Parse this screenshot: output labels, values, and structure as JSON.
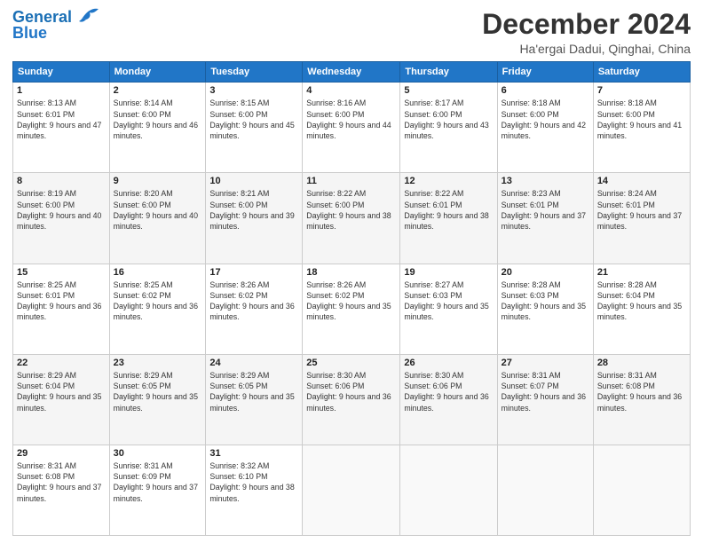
{
  "logo": {
    "line1": "General",
    "line2": "Blue"
  },
  "title": "December 2024",
  "subtitle": "Ha'ergai Dadui, Qinghai, China",
  "weekdays": [
    "Sunday",
    "Monday",
    "Tuesday",
    "Wednesday",
    "Thursday",
    "Friday",
    "Saturday"
  ],
  "weeks": [
    [
      {
        "day": "1",
        "sunrise": "8:13 AM",
        "sunset": "6:01 PM",
        "daylight": "9 hours and 47 minutes."
      },
      {
        "day": "2",
        "sunrise": "8:14 AM",
        "sunset": "6:00 PM",
        "daylight": "9 hours and 46 minutes."
      },
      {
        "day": "3",
        "sunrise": "8:15 AM",
        "sunset": "6:00 PM",
        "daylight": "9 hours and 45 minutes."
      },
      {
        "day": "4",
        "sunrise": "8:16 AM",
        "sunset": "6:00 PM",
        "daylight": "9 hours and 44 minutes."
      },
      {
        "day": "5",
        "sunrise": "8:17 AM",
        "sunset": "6:00 PM",
        "daylight": "9 hours and 43 minutes."
      },
      {
        "day": "6",
        "sunrise": "8:18 AM",
        "sunset": "6:00 PM",
        "daylight": "9 hours and 42 minutes."
      },
      {
        "day": "7",
        "sunrise": "8:18 AM",
        "sunset": "6:00 PM",
        "daylight": "9 hours and 41 minutes."
      }
    ],
    [
      {
        "day": "8",
        "sunrise": "8:19 AM",
        "sunset": "6:00 PM",
        "daylight": "9 hours and 40 minutes."
      },
      {
        "day": "9",
        "sunrise": "8:20 AM",
        "sunset": "6:00 PM",
        "daylight": "9 hours and 40 minutes."
      },
      {
        "day": "10",
        "sunrise": "8:21 AM",
        "sunset": "6:00 PM",
        "daylight": "9 hours and 39 minutes."
      },
      {
        "day": "11",
        "sunrise": "8:22 AM",
        "sunset": "6:00 PM",
        "daylight": "9 hours and 38 minutes."
      },
      {
        "day": "12",
        "sunrise": "8:22 AM",
        "sunset": "6:01 PM",
        "daylight": "9 hours and 38 minutes."
      },
      {
        "day": "13",
        "sunrise": "8:23 AM",
        "sunset": "6:01 PM",
        "daylight": "9 hours and 37 minutes."
      },
      {
        "day": "14",
        "sunrise": "8:24 AM",
        "sunset": "6:01 PM",
        "daylight": "9 hours and 37 minutes."
      }
    ],
    [
      {
        "day": "15",
        "sunrise": "8:25 AM",
        "sunset": "6:01 PM",
        "daylight": "9 hours and 36 minutes."
      },
      {
        "day": "16",
        "sunrise": "8:25 AM",
        "sunset": "6:02 PM",
        "daylight": "9 hours and 36 minutes."
      },
      {
        "day": "17",
        "sunrise": "8:26 AM",
        "sunset": "6:02 PM",
        "daylight": "9 hours and 36 minutes."
      },
      {
        "day": "18",
        "sunrise": "8:26 AM",
        "sunset": "6:02 PM",
        "daylight": "9 hours and 35 minutes."
      },
      {
        "day": "19",
        "sunrise": "8:27 AM",
        "sunset": "6:03 PM",
        "daylight": "9 hours and 35 minutes."
      },
      {
        "day": "20",
        "sunrise": "8:28 AM",
        "sunset": "6:03 PM",
        "daylight": "9 hours and 35 minutes."
      },
      {
        "day": "21",
        "sunrise": "8:28 AM",
        "sunset": "6:04 PM",
        "daylight": "9 hours and 35 minutes."
      }
    ],
    [
      {
        "day": "22",
        "sunrise": "8:29 AM",
        "sunset": "6:04 PM",
        "daylight": "9 hours and 35 minutes."
      },
      {
        "day": "23",
        "sunrise": "8:29 AM",
        "sunset": "6:05 PM",
        "daylight": "9 hours and 35 minutes."
      },
      {
        "day": "24",
        "sunrise": "8:29 AM",
        "sunset": "6:05 PM",
        "daylight": "9 hours and 35 minutes."
      },
      {
        "day": "25",
        "sunrise": "8:30 AM",
        "sunset": "6:06 PM",
        "daylight": "9 hours and 36 minutes."
      },
      {
        "day": "26",
        "sunrise": "8:30 AM",
        "sunset": "6:06 PM",
        "daylight": "9 hours and 36 minutes."
      },
      {
        "day": "27",
        "sunrise": "8:31 AM",
        "sunset": "6:07 PM",
        "daylight": "9 hours and 36 minutes."
      },
      {
        "day": "28",
        "sunrise": "8:31 AM",
        "sunset": "6:08 PM",
        "daylight": "9 hours and 36 minutes."
      }
    ],
    [
      {
        "day": "29",
        "sunrise": "8:31 AM",
        "sunset": "6:08 PM",
        "daylight": "9 hours and 37 minutes."
      },
      {
        "day": "30",
        "sunrise": "8:31 AM",
        "sunset": "6:09 PM",
        "daylight": "9 hours and 37 minutes."
      },
      {
        "day": "31",
        "sunrise": "8:32 AM",
        "sunset": "6:10 PM",
        "daylight": "9 hours and 38 minutes."
      },
      null,
      null,
      null,
      null
    ]
  ]
}
